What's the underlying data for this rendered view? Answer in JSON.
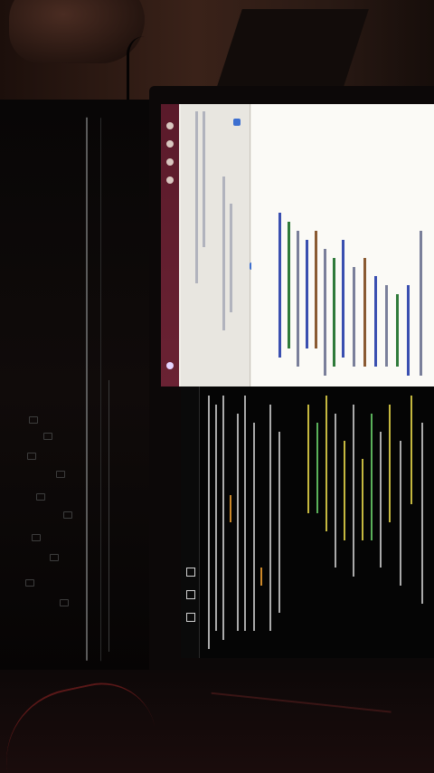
{
  "photo": {
    "subject": "laptop",
    "screens": [
      {
        "kind": "code-editor",
        "theme": "light"
      },
      {
        "kind": "terminal",
        "theme": "dark"
      }
    ]
  },
  "palette": {
    "background": "#0b0706",
    "launcher": "#5a1a2a",
    "editor_bg": "#fbfaf6",
    "terminal_bg": "#050505",
    "terminal_text_yellow": "#e8d84a"
  }
}
